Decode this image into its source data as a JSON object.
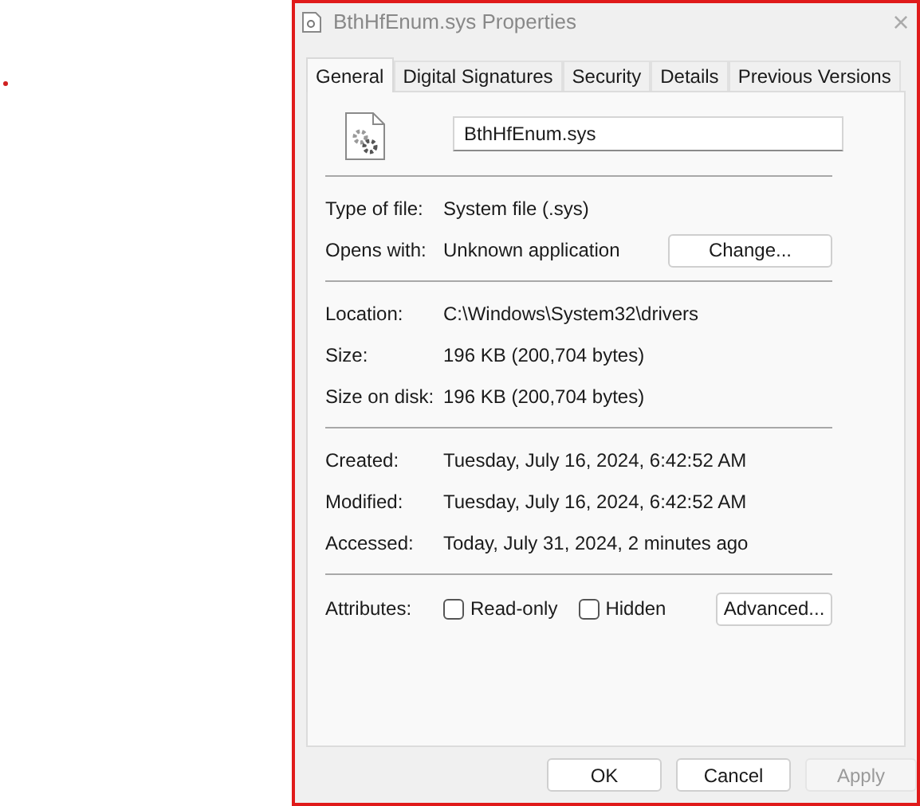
{
  "window": {
    "title": "BthHfEnum.sys Properties",
    "close": "×"
  },
  "tabs": [
    {
      "label": "General",
      "selected": true
    },
    {
      "label": "Digital Signatures",
      "selected": false
    },
    {
      "label": "Security",
      "selected": false
    },
    {
      "label": "Details",
      "selected": false
    },
    {
      "label": "Previous Versions",
      "selected": false
    }
  ],
  "file_name": {
    "value": "BthHfEnum.sys"
  },
  "sections": [
    {
      "rows": [
        {
          "label": "Type of file:",
          "value": "System file (.sys)"
        },
        {
          "label": "Opens with:",
          "value": "Unknown application",
          "button": "Change..."
        }
      ]
    },
    {
      "rows": [
        {
          "label": "Location:",
          "value": "C:\\Windows\\System32\\drivers"
        },
        {
          "label": "Size:",
          "value": "196 KB (200,704 bytes)"
        },
        {
          "label": "Size on disk:",
          "value": "196 KB (200,704 bytes)"
        }
      ]
    },
    {
      "rows": [
        {
          "label": "Created:",
          "value": "Tuesday, July 16, 2024, 6:42:52 AM"
        },
        {
          "label": "Modified:",
          "value": "Tuesday, July 16, 2024, 6:42:52 AM"
        },
        {
          "label": "Accessed:",
          "value": "Today, July 31, 2024, 2 minutes ago"
        }
      ]
    }
  ],
  "attributes": {
    "label": "Attributes:",
    "checkboxes": [
      {
        "label": "Read-only",
        "checked": false
      },
      {
        "label": "Hidden",
        "checked": false
      }
    ],
    "button": "Advanced..."
  },
  "buttons": [
    {
      "label": "OK",
      "disabled": false
    },
    {
      "label": "Cancel",
      "disabled": false
    },
    {
      "label": "Apply",
      "disabled": true
    }
  ]
}
